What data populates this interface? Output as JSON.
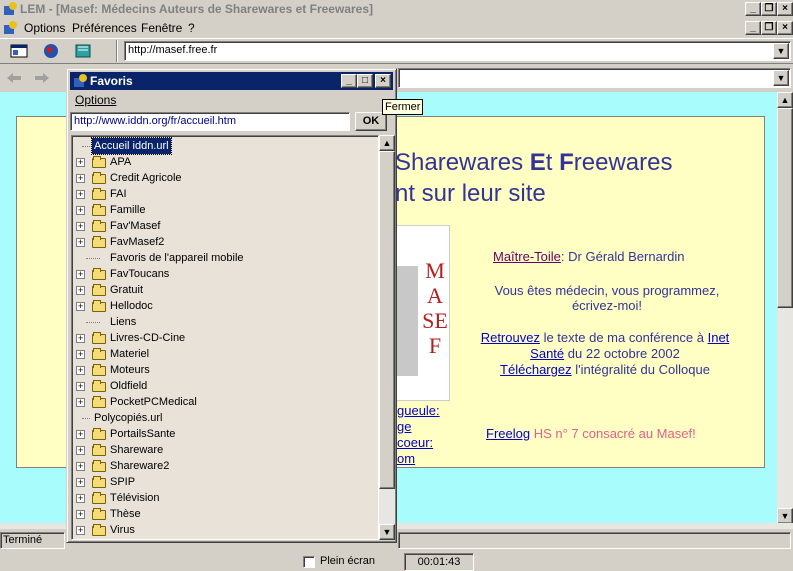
{
  "window": {
    "title": "LEM - [Masef: Médecins Auteurs de Sharewares et Freewares]"
  },
  "menu": [
    "Options",
    "Préférences",
    "Fenêtre",
    "?"
  ],
  "address": {
    "url": "http://masef.free.fr",
    "second_value": ""
  },
  "favorites": {
    "title": "Favoris",
    "menu": "Options",
    "url_value": "http://www.iddn.org/fr/accueil.htm",
    "ok_label": "OK",
    "items": [
      {
        "label": "Accueil iddn.url",
        "type": "file",
        "selected": true
      },
      {
        "label": "APA",
        "type": "folder"
      },
      {
        "label": "Credit Agricole",
        "type": "folder"
      },
      {
        "label": "FAI",
        "type": "folder"
      },
      {
        "label": "Famille",
        "type": "folder"
      },
      {
        "label": "Fav'Masef",
        "type": "folder"
      },
      {
        "label": "FavMasef2",
        "type": "folder"
      },
      {
        "label": "Favoris de l'appareil mobile",
        "type": "file-folder"
      },
      {
        "label": "FavToucans",
        "type": "folder"
      },
      {
        "label": "Gratuit",
        "type": "folder"
      },
      {
        "label": "Hellodoc",
        "type": "folder"
      },
      {
        "label": "Liens",
        "type": "file-folder"
      },
      {
        "label": "Livres-CD-Cine",
        "type": "folder"
      },
      {
        "label": "Materiel",
        "type": "folder"
      },
      {
        "label": "Moteurs",
        "type": "folder"
      },
      {
        "label": "Oldfield",
        "type": "folder"
      },
      {
        "label": "PocketPCMedical",
        "type": "folder"
      },
      {
        "label": "Polycopiés.url",
        "type": "file"
      },
      {
        "label": "PortailsSante",
        "type": "folder"
      },
      {
        "label": "Shareware",
        "type": "folder"
      },
      {
        "label": "Shareware2",
        "type": "folder"
      },
      {
        "label": "SPIP",
        "type": "folder"
      },
      {
        "label": "Télévision",
        "type": "folder"
      },
      {
        "label": "Thèse",
        "type": "folder"
      },
      {
        "label": "Virus",
        "type": "folder"
      }
    ]
  },
  "tooltip": "Fermer",
  "page": {
    "heading_part1": "Sharewares ",
    "heading_E": "E",
    "heading_part2": "t ",
    "heading_F": "F",
    "heading_part3": "reewares",
    "heading_line2": "nt sur leur site",
    "masef_logo": "MASEF",
    "maitre_link": "Maître-Toile",
    "maitre_text": ": Dr Gérald Bernardin",
    "medecin_line1": "Vous êtes médecin, vous programmez,",
    "medecin_line2": "écrivez-moi!",
    "retrouvez_link": "Retrouvez",
    "retrouvez_text": " le texte de ma conférence à ",
    "inet_link": "Inet",
    "sante_link": "Santé",
    "date_text": " du 22 octobre 2002",
    "telecharger_link": "Téléchargez",
    "telecharger_text": " l'intégralité du Colloque",
    "partial1": "gueule:",
    "partial2": "ge",
    "partial3": "coeur:",
    "partial4": "om",
    "freelog_link": "Freelog",
    "freelog_text": " HS n° 7 consacré au Masef!"
  },
  "status": {
    "text": "Terminé",
    "fullscreen_label": "Plein écran",
    "time": "00:01:43"
  }
}
